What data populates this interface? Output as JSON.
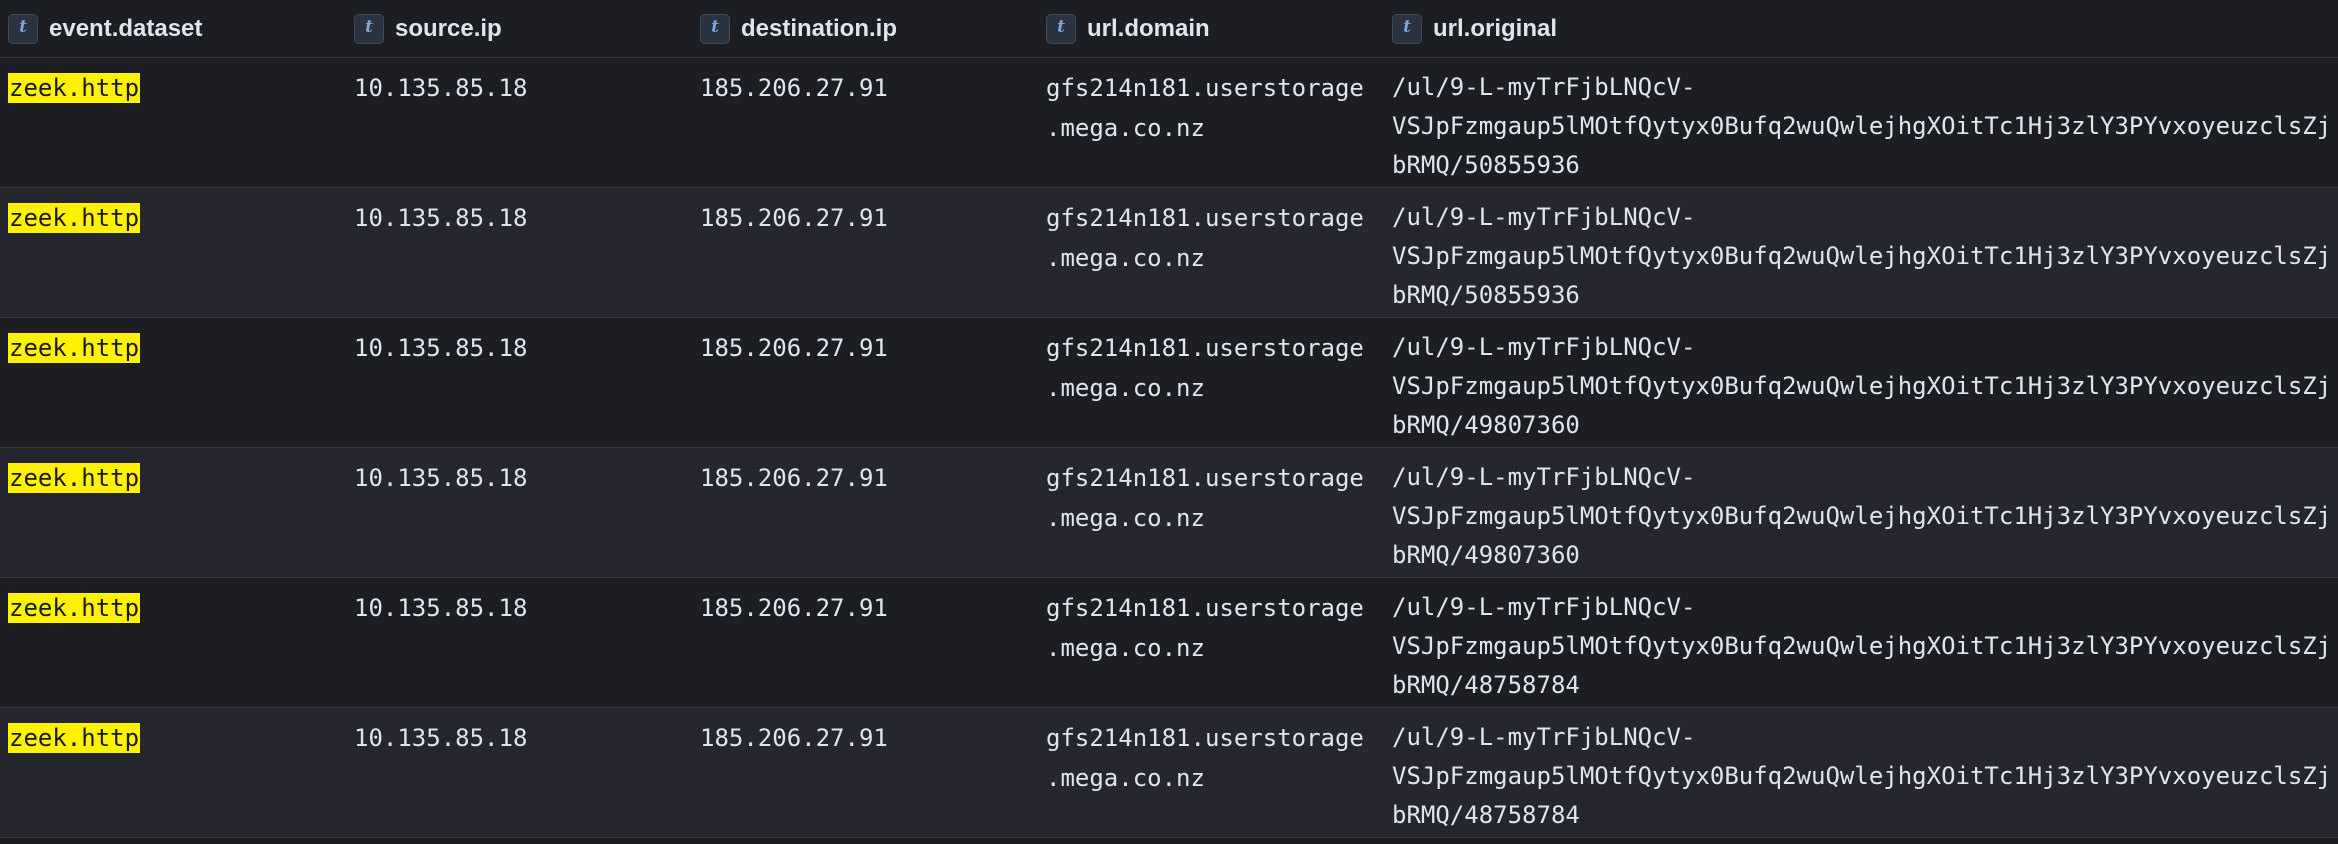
{
  "columns": [
    {
      "type_icon": "t",
      "label": "event.dataset"
    },
    {
      "type_icon": "t",
      "label": "source.ip"
    },
    {
      "type_icon": "t",
      "label": "destination.ip"
    },
    {
      "type_icon": "t",
      "label": "url.domain"
    },
    {
      "type_icon": "t",
      "label": "url.original"
    }
  ],
  "rows": [
    {
      "event_dataset": "zeek.http",
      "source_ip": "10.135.85.18",
      "destination_ip": "185.206.27.91",
      "url_domain": [
        "gfs214n181.userstorage",
        ".mega.co.nz"
      ],
      "url_original": [
        "/ul/9-L-myTrFjbLNQcV-",
        "VSJpFzmgaup5lMOtfQytyx0Bufq2wuQwlejhgXOitTc1Hj3zlY3PYvxoyeuzclsZj",
        "bRMQ/50855936"
      ]
    },
    {
      "event_dataset": "zeek.http",
      "source_ip": "10.135.85.18",
      "destination_ip": "185.206.27.91",
      "url_domain": [
        "gfs214n181.userstorage",
        ".mega.co.nz"
      ],
      "url_original": [
        "/ul/9-L-myTrFjbLNQcV-",
        "VSJpFzmgaup5lMOtfQytyx0Bufq2wuQwlejhgXOitTc1Hj3zlY3PYvxoyeuzclsZj",
        "bRMQ/50855936"
      ]
    },
    {
      "event_dataset": "zeek.http",
      "source_ip": "10.135.85.18",
      "destination_ip": "185.206.27.91",
      "url_domain": [
        "gfs214n181.userstorage",
        ".mega.co.nz"
      ],
      "url_original": [
        "/ul/9-L-myTrFjbLNQcV-",
        "VSJpFzmgaup5lMOtfQytyx0Bufq2wuQwlejhgXOitTc1Hj3zlY3PYvxoyeuzclsZj",
        "bRMQ/49807360"
      ]
    },
    {
      "event_dataset": "zeek.http",
      "source_ip": "10.135.85.18",
      "destination_ip": "185.206.27.91",
      "url_domain": [
        "gfs214n181.userstorage",
        ".mega.co.nz"
      ],
      "url_original": [
        "/ul/9-L-myTrFjbLNQcV-",
        "VSJpFzmgaup5lMOtfQytyx0Bufq2wuQwlejhgXOitTc1Hj3zlY3PYvxoyeuzclsZj",
        "bRMQ/49807360"
      ]
    },
    {
      "event_dataset": "zeek.http",
      "source_ip": "10.135.85.18",
      "destination_ip": "185.206.27.91",
      "url_domain": [
        "gfs214n181.userstorage",
        ".mega.co.nz"
      ],
      "url_original": [
        "/ul/9-L-myTrFjbLNQcV-",
        "VSJpFzmgaup5lMOtfQytyx0Bufq2wuQwlejhgXOitTc1Hj3zlY3PYvxoyeuzclsZj",
        "bRMQ/48758784"
      ]
    },
    {
      "event_dataset": "zeek.http",
      "source_ip": "10.135.85.18",
      "destination_ip": "185.206.27.91",
      "url_domain": [
        "gfs214n181.userstorage",
        ".mega.co.nz"
      ],
      "url_original": [
        "/ul/9-L-myTrFjbLNQcV-",
        "VSJpFzmgaup5lMOtfQytyx0Bufq2wuQwlejhgXOitTc1Hj3zlY3PYvxoyeuzclsZj",
        "bRMQ/48758784"
      ]
    }
  ],
  "colors": {
    "background": "#1d1e24",
    "row_alt": "#25262e",
    "highlight": "#fff200",
    "type_icon": "#7aa6d6"
  }
}
